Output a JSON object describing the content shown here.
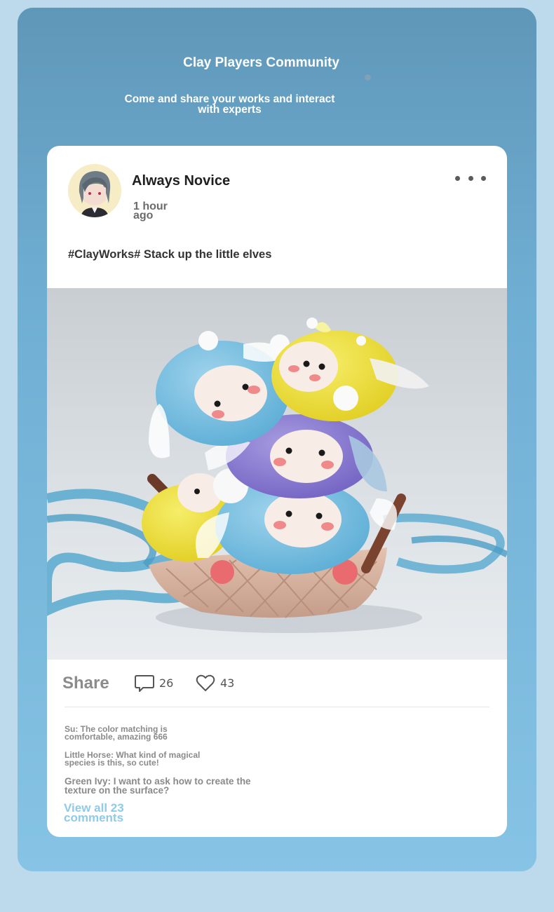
{
  "header": {
    "title": "Clay Players Community",
    "subtitle": "Come and share your works and interact with experts"
  },
  "post": {
    "username": "Always Novice",
    "time": "1 hour ago",
    "text": "#ClayWorks# Stack up the little elves",
    "image_icon": "clay-elves-photo"
  },
  "actions": {
    "share_label": "Share",
    "comments_count": "26",
    "likes_count": "43"
  },
  "comments": [
    {
      "text": "Su: The color matching is comfortable, amazing 666"
    },
    {
      "text": "Little Horse: What kind of magical species is this, so cute!"
    },
    {
      "text": "Green Ivy: I want to ask how to create the texture on the surface?"
    }
  ],
  "view_all_label": "View all 23 comments",
  "colors": {
    "page_bg": "#bcdaeb",
    "panel_top": "#5f97b8",
    "panel_bottom": "#86c3e4",
    "link": "#8ecbe9"
  }
}
